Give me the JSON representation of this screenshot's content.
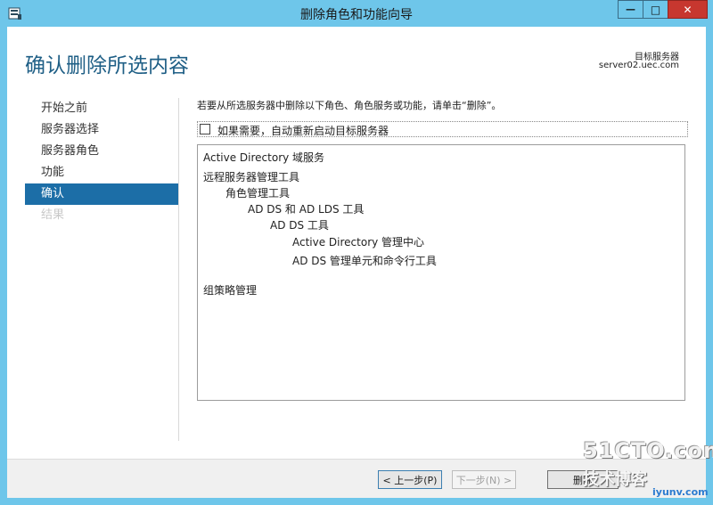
{
  "window": {
    "title": "删除角色和功能向导",
    "min_glyph": "—",
    "max_glyph": "□",
    "close_glyph": "✕"
  },
  "header": {
    "page_title": "确认删除所选内容",
    "target_server_label": "目标服务器",
    "target_server_value": "server02.uec.com"
  },
  "nav": {
    "items": [
      {
        "label": "开始之前",
        "state": "normal"
      },
      {
        "label": "服务器选择",
        "state": "normal"
      },
      {
        "label": "服务器角色",
        "state": "normal"
      },
      {
        "label": "功能",
        "state": "normal"
      },
      {
        "label": "确认",
        "state": "active"
      },
      {
        "label": "结果",
        "state": "disabled"
      }
    ]
  },
  "content": {
    "instruction": "若要从所选服务器中删除以下角色、角色服务或功能，请单击“删除”。",
    "restart_checkbox_label": "如果需要，自动重新启动目标服务器",
    "restart_checked": false,
    "items": [
      "Active Directory 域服务",
      "远程服务器管理工具",
      "角色管理工具",
      "AD DS 和 AD LDS 工具",
      "AD DS 工具",
      "Active Directory 管理中心",
      "AD DS 管理单元和命令行工具",
      "组策略管理"
    ]
  },
  "footer": {
    "prev_label": "< 上一步(P)",
    "next_label": "下一步(N) >",
    "remove_label": "删除"
  },
  "watermark": {
    "main": "51CTO.com",
    "sub": "技术博客",
    "url": "iyunv.com"
  },
  "colors": {
    "title_bar": "#6ec6ea",
    "accent": "#1c6ea7",
    "page_title": "#1f5f86",
    "close_button": "#c7372f"
  }
}
